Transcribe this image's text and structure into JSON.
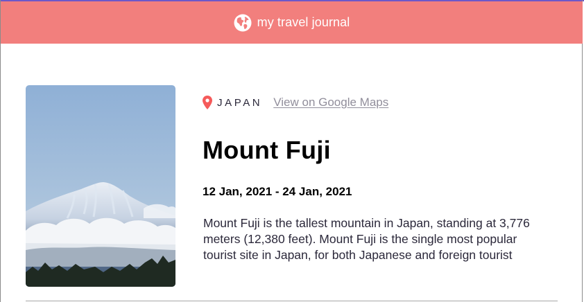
{
  "header": {
    "title": "my travel journal",
    "icon": "globe-icon",
    "background_color": "#f27f7d"
  },
  "entry": {
    "image_description_icon": "mount-fuji-photo",
    "location": {
      "icon": "map-pin-icon",
      "pin_color": "#f55a5a",
      "country": "JAPAN",
      "maps_link_label": "View on Google Maps"
    },
    "title": "Mount Fuji",
    "dates": "12 Jan, 2021 - 24 Jan, 2021",
    "description": "Mount Fuji is the tallest mountain in Japan, standing at 3,776 meters (12,380 feet). Mount Fuji is the single most popular tourist site in Japan, for both Japanese and foreign tourist"
  }
}
